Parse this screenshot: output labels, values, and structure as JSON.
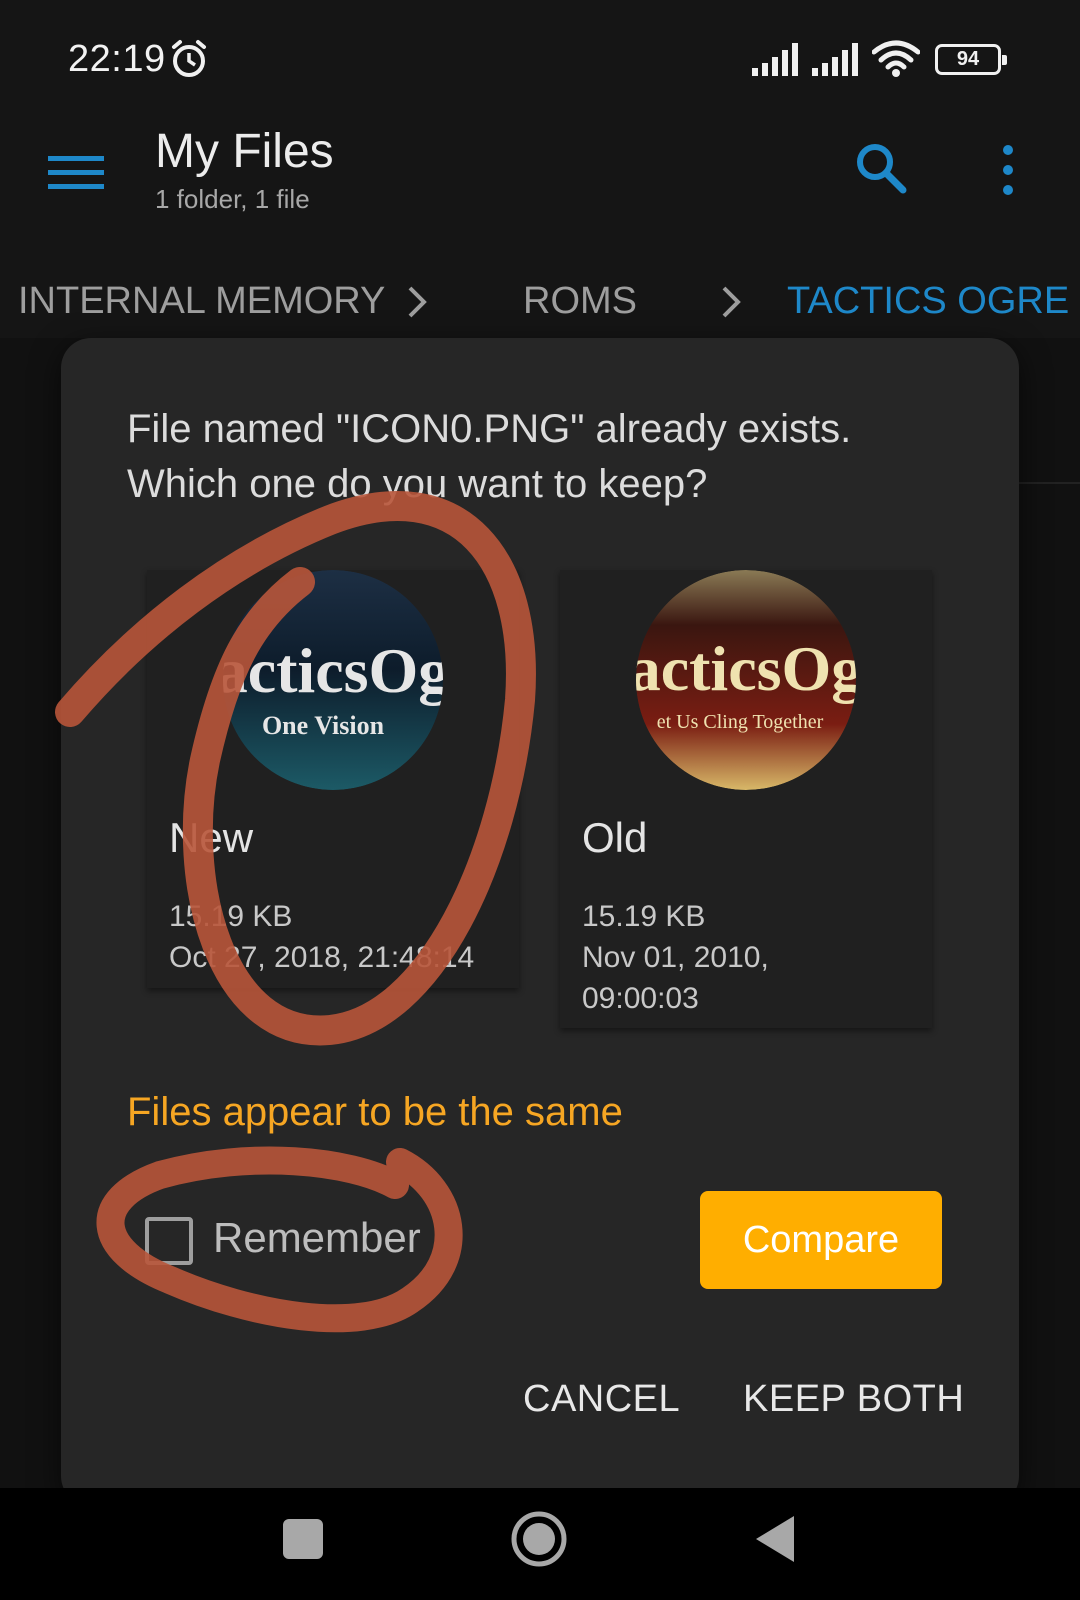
{
  "status_bar": {
    "time": "22:19",
    "battery": "94"
  },
  "app_bar": {
    "title": "My Files",
    "subtitle": "1 folder, 1 file"
  },
  "breadcrumb": [
    "INTERNAL MEMORY",
    "ROMS",
    "TACTICS OGRE"
  ],
  "dialog": {
    "message": "File named \"ICON0.PNG\" already exists. Which one do you want to keep?",
    "files": [
      {
        "label": "New",
        "size": "15.19 KB",
        "date": "Oct 27, 2018, 21:48:14",
        "thumb_text": "acticsOg",
        "thumb_subtext": "One Vision"
      },
      {
        "label": "Old",
        "size": "15.19 KB",
        "date": "Nov 01, 2010, 09:00:03",
        "thumb_text": "acticsOg",
        "thumb_subtext": "et Us Cling Together"
      }
    ],
    "same_message": "Files appear to be the same",
    "remember_label": "Remember",
    "compare_label": "Compare",
    "cancel_label": "CANCEL",
    "keep_both_label": "KEEP BOTH"
  },
  "colors": {
    "accent": "#1e88c9",
    "warning": "#f6a623",
    "compare_button": "#ffae00",
    "annotation": "#b8553a"
  }
}
